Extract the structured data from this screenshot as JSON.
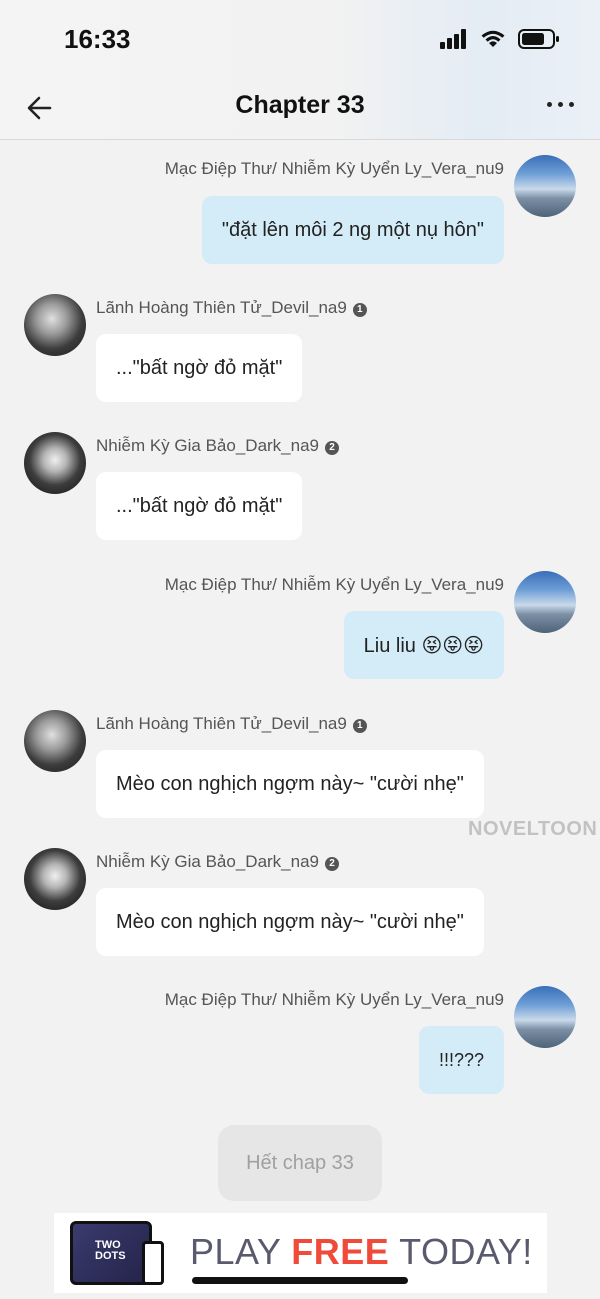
{
  "status": {
    "time": "16:33"
  },
  "header": {
    "title": "Chapter 33"
  },
  "messages": [
    {
      "side": "right",
      "name": "Mạc Điệp Thư/ Nhiễm Kỳ Uyển Ly_Vera_nu9",
      "text": "\"đặt lên môi 2 ng một nụ hôn\""
    },
    {
      "side": "left",
      "name": "Lãnh Hoàng Thiên Tử_Devil_na9",
      "badge": "1",
      "text": "...\"bất ngờ đỏ mặt\""
    },
    {
      "side": "left",
      "name": "Nhiễm Kỳ Gia Bảo_Dark_na9",
      "badge": "2",
      "text": "...\"bất ngờ đỏ mặt\""
    },
    {
      "side": "right",
      "name": "Mạc Điệp Thư/ Nhiễm Kỳ Uyển Ly_Vera_nu9",
      "text": "Liu liu 😝😝😝"
    },
    {
      "side": "left",
      "name": "Lãnh Hoàng Thiên Tử_Devil_na9",
      "badge": "1",
      "text": "Mèo con nghịch ngợm này~ \"cười nhẹ\""
    },
    {
      "side": "left",
      "name": "Nhiễm Kỳ Gia Bảo_Dark_na9",
      "badge": "2",
      "text": "Mèo con nghịch ngợm này~ \"cười nhẹ\""
    },
    {
      "side": "right",
      "name": "Mạc Điệp Thư/ Nhiễm Kỳ Uyển Ly_Vera_nu9",
      "text": "!!!???"
    }
  ],
  "end_label": "Hết chap 33",
  "watermark": "NOVELTOON",
  "ad": {
    "thumb_text": "TWO DOTS",
    "text_before": "PLAY ",
    "text_highlight": "FREE",
    "text_after": " TODAY!"
  },
  "colors": {
    "bubble_right": "#d4ecf8",
    "bubble_left": "#ffffff",
    "background": "#f2f2f2",
    "ad_highlight": "#ef4a3a"
  }
}
